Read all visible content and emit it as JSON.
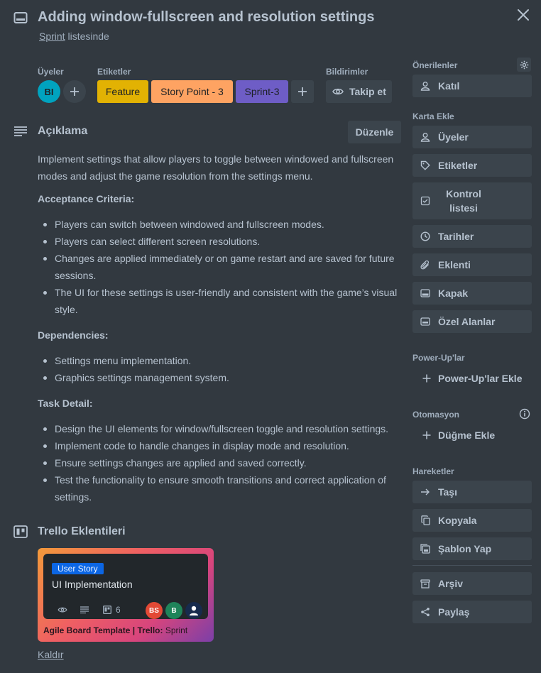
{
  "header": {
    "title": "Adding window-fullscreen and resolution settings",
    "list_link": "Sprint",
    "list_suffix": " listesinde"
  },
  "members": {
    "label": "Üyeler",
    "avatar_initials": "BI",
    "avatar_color": "#00a3bf"
  },
  "labels": {
    "label": "Etiketler",
    "items": [
      {
        "text": "Feature",
        "color": "#e2b203"
      },
      {
        "text": "Story Point - 3",
        "color": "#fea362"
      },
      {
        "text": "Sprint-3",
        "color": "#6e5dc6"
      }
    ]
  },
  "notifications": {
    "label": "Bildirimler",
    "watch_label": "Takip et"
  },
  "description": {
    "heading": "Açıklama",
    "edit_label": "Düzenle",
    "intro": "Implement settings that allow players to toggle between windowed and fullscreen modes and adjust the game resolution from the settings menu.",
    "sections": [
      {
        "title": "Acceptance Criteria:",
        "items": [
          "Players can switch between windowed and fullscreen modes.",
          "Players can select different screen resolutions.",
          "Changes are applied immediately or on game restart and are saved for future sessions.",
          "The UI for these settings is user-friendly and consistent with the game’s visual style."
        ]
      },
      {
        "title": "Dependencies:",
        "items": [
          "Settings menu implementation.",
          "Graphics settings management system."
        ]
      },
      {
        "title": "Task Detail:",
        "items": [
          "Design the UI elements for window/fullscreen toggle and resolution settings.",
          "Implement code to handle changes in display mode and resolution.",
          "Ensure settings changes are applied and saved correctly.",
          "Test the functionality to ensure smooth transitions and correct application of settings."
        ]
      }
    ]
  },
  "addons": {
    "heading": "Trello Eklentileri",
    "card": {
      "badge": "User Story",
      "title": "UI Implementation",
      "checklist_count": "6",
      "avatars": [
        {
          "initials": "BS",
          "color": "#e34935"
        },
        {
          "initials": "B",
          "color": "#1f845a"
        },
        {
          "initials": "",
          "color": "#172b4d"
        }
      ],
      "footer_board": "Agile Board Template | Trello:",
      "footer_list": " Sprint"
    },
    "remove_label": "Kaldır"
  },
  "sidebar": {
    "suggested_label": "Önerilenler",
    "join_label": "Katıl",
    "add_to_card_label": "Karta Ekle",
    "add_items": [
      {
        "label": "Üyeler",
        "icon": "person-icon"
      },
      {
        "label": "Etiketler",
        "icon": "tag-icon"
      },
      {
        "label": "Kontrol listesi",
        "icon": "checklist-icon"
      },
      {
        "label": "Tarihler",
        "icon": "clock-icon"
      },
      {
        "label": "Eklenti",
        "icon": "paperclip-icon"
      },
      {
        "label": "Kapak",
        "icon": "cover-icon"
      },
      {
        "label": "Özel Alanlar",
        "icon": "custom-fields-icon"
      }
    ],
    "powerups_label": "Power-Up'lar",
    "powerups_add": "Power-Up'lar Ekle",
    "automation_label": "Otomasyon",
    "automation_add": "Düğme Ekle",
    "actions_label": "Hareketler",
    "actions": [
      {
        "label": "Taşı",
        "icon": "arrow-right-icon"
      },
      {
        "label": "Kopyala",
        "icon": "copy-icon"
      },
      {
        "label": "Şablon Yap",
        "icon": "template-icon"
      },
      {
        "label": "Arşiv",
        "icon": "archive-icon"
      },
      {
        "label": "Paylaş",
        "icon": "share-icon"
      }
    ]
  }
}
